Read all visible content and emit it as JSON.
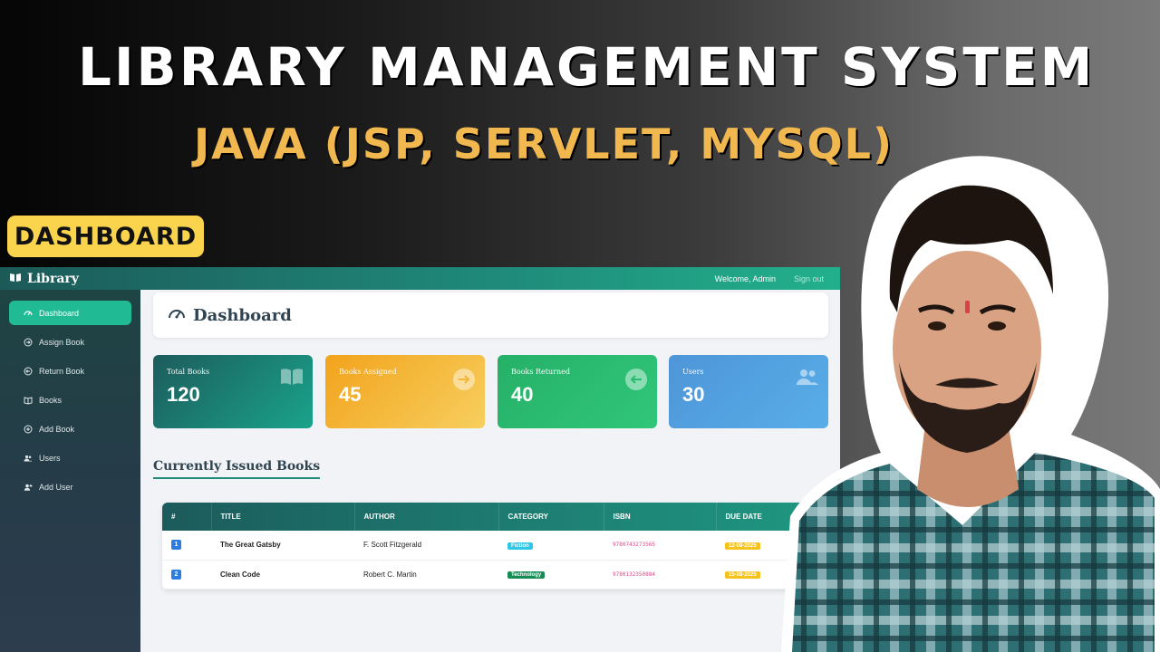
{
  "thumbnail": {
    "headline": "LIBRARY MANAGEMENT SYSTEM",
    "subheadline": "JAVA (JSP, SERVLET, MYSQL)",
    "section_tag": "DASHBOARD"
  },
  "app": {
    "brand": "Library",
    "welcome_text": "Welcome, Admin",
    "signout_label": "Sign out"
  },
  "sidebar": {
    "items": [
      {
        "label": "Dashboard",
        "icon": "gauge-icon"
      },
      {
        "label": "Assign Book",
        "icon": "arrow-right-circle-icon"
      },
      {
        "label": "Return Book",
        "icon": "arrow-left-circle-icon"
      },
      {
        "label": "Books",
        "icon": "open-book-icon"
      },
      {
        "label": "Add Book",
        "icon": "plus-circle-icon"
      },
      {
        "label": "Users",
        "icon": "users-icon"
      },
      {
        "label": "Add User",
        "icon": "user-plus-icon"
      }
    ]
  },
  "page": {
    "title": "Dashboard",
    "section_title": "Currently Issued Books"
  },
  "stats": [
    {
      "label": "Total Books",
      "value": "120",
      "icon": "book-icon"
    },
    {
      "label": "Books Assigned",
      "value": "45",
      "icon": "arrow-right-circle-icon"
    },
    {
      "label": "Books Returned",
      "value": "40",
      "icon": "arrow-left-circle-icon"
    },
    {
      "label": "Users",
      "value": "30",
      "icon": "users-icon"
    }
  ],
  "table": {
    "columns": [
      "#",
      "TITLE",
      "AUTHOR",
      "CATEGORY",
      "ISBN",
      "DUE DATE"
    ],
    "rows": [
      {
        "num": "1",
        "title": "The Great Gatsby",
        "author": "F. Scott Fitzgerald",
        "category": "Fiction",
        "isbn": "9780743273565",
        "due": "12-08-2025"
      },
      {
        "num": "2",
        "title": "Clean Code",
        "author": "Robert C. Martin",
        "category": "Technology",
        "isbn": "9780132350884",
        "due": "15-08-2025"
      }
    ]
  },
  "colors": {
    "accent_teal": "#1f8b7a",
    "active_nav": "#20bb94",
    "tag_yellow": "#fbd44e",
    "subhead_gold": "#f0b84e",
    "category_fiction": "#2ec8e6",
    "category_technology": "#178b55"
  }
}
